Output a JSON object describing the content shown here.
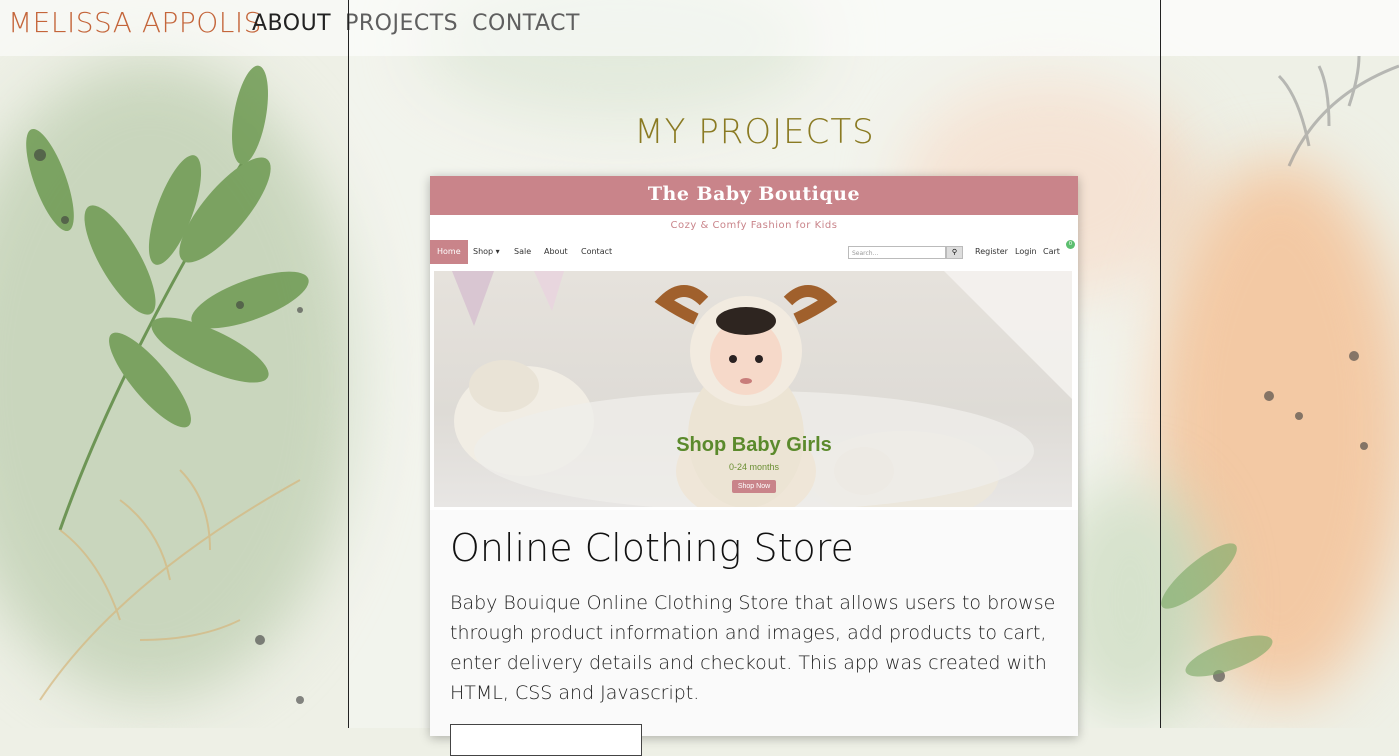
{
  "brand": "MELISSA APPOLIS",
  "nav": [
    "ABOUT",
    "PROJECTS",
    "CONTACT"
  ],
  "section_title": "MY PROJECTS",
  "project": {
    "screenshot": {
      "site_title": "The Baby Boutique",
      "tagline": "Cozy & Comfy Fashion for Kids",
      "nav_items": [
        "Home",
        "Shop ▾",
        "Sale",
        "About",
        "Contact"
      ],
      "search_placeholder": "Search...",
      "right_links": [
        "Register",
        "Login",
        "Cart"
      ],
      "cart_count": "0",
      "hero_heading": "Shop Baby Girls",
      "hero_sub": "0-24 months",
      "hero_button": "Shop Now"
    },
    "title": "Online Clothing Store",
    "description": "Baby Bouique Online Clothing Store that allows users to browse through product information and images, add products to cart, enter delivery details and checkout. This app was created with HTML, CSS and Javascript."
  },
  "colors": {
    "brand": "#c4653a",
    "section_title": "#8a7a22",
    "boutique_pink": "#c9848a",
    "hero_green": "#5b8a2c"
  }
}
